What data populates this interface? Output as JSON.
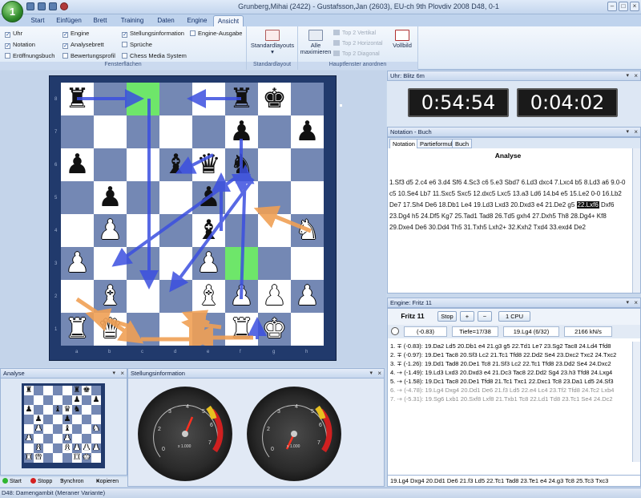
{
  "window": {
    "title": "Grunberg,Mihai (2422) - Gustafsson,Jan (2603), EU-ch 9th Plovdiv 2008 D48, 0-1",
    "logo_glyph": "1"
  },
  "ribbon": {
    "tabs": [
      "Start",
      "Einfügen",
      "Brett",
      "Training",
      "Daten",
      "Engine",
      "Ansicht"
    ],
    "active_tab": "Ansicht",
    "fensterflaechen": {
      "label": "Fensterflächen",
      "checkboxes": [
        {
          "label": "Uhr",
          "checked": true
        },
        {
          "label": "Notation",
          "checked": true
        },
        {
          "label": "Eröffnungsbuch",
          "checked": false
        },
        {
          "label": "Engine",
          "checked": true
        },
        {
          "label": "Analysebrett",
          "checked": true
        },
        {
          "label": "Bewertungsprofil",
          "checked": false
        },
        {
          "label": "Stellungsinformation",
          "checked": true
        },
        {
          "label": "Sprüche",
          "checked": false
        },
        {
          "label": "Chess Media System",
          "checked": false
        },
        {
          "label": "Engine-Ausgabe",
          "checked": false
        }
      ]
    },
    "standardlayout": {
      "label": "Standardlayout",
      "button": "Standardlayouts"
    },
    "hauptfenster": {
      "label": "Hauptfenster anordnen",
      "maximize": "Alle maximieren",
      "top2_vertical": "Top 2 Vertikal",
      "top2_horizontal": "Top 2 Horizontal",
      "top2_diagonal": "Top 2 Diagonal",
      "fullscreen": "Vollbild"
    }
  },
  "board": {
    "files": [
      "a",
      "b",
      "c",
      "d",
      "e",
      "f",
      "g",
      "h"
    ],
    "ranks": [
      "8",
      "7",
      "6",
      "5",
      "4",
      "3",
      "2",
      "1"
    ]
  },
  "clock": {
    "title": "Uhr: Blitz 6m",
    "white_time": "0:54:54",
    "black_time": "0:04:02"
  },
  "notation": {
    "title": "Notation - Buch",
    "tabs": [
      "Notation",
      "Partieformular",
      "Buch"
    ],
    "active_tab": "Notation",
    "heading": "Analyse",
    "moves_before": "1.Sf3 d5 2.c4 e6 3.d4 Sf6 4.Sc3 c6 5.e3 Sbd7 6.Ld3 dxc4 7.Lxc4 b5 8.Ld3 a6 9.0-0 c5 10.Se4 Lb7 11.Sxc5 Sxc5 12.dxc5 Lxc5 13.a3 Ld6 14.b4 e5 15.Le2 0-0 16.Lb2 De7 17.Sh4 De6 18.Db1 Le4 19.Ld3 Lxd3 20.Dxd3 e4 21.De2 g5",
    "current_move": "22.Lxf6",
    "moves_after": "Dxf6 23.Dg4 h5 24.Df5 Kg7 25.Tad1 Tad8 26.Td5 gxh4 27.Dxh5 Th8 28.Dg4+ Kf8 29.Dxe4 De6 30.Dd4 Th5 31.Txh5 Lxh2+ 32.Kxh2 Txd4 33.exd4 De2"
  },
  "engine": {
    "title": "Engine: Fritz 11",
    "name": "Fritz 11",
    "stop": "Stop",
    "plus": "+",
    "minus": "−",
    "cpu": "1 CPU",
    "eval": "(-0.83)",
    "depth": "Tiefe=17/38",
    "current_move": "19.Lg4 (6/32)",
    "speed": "2166 kN/s",
    "lines": [
      "1. ∓ (-0.83): 19.Da2 Ld5 20.Db1 e4 21.g3 g5 22.Td1 Le7 23.Sg2 Tac8 24.Ld4 Tfd8",
      "2. ∓ (-0.97): 19.De1 Tac8 20.Sf3 Lc2 21.Tc1 Tfd8 22.Dd2 Se4 23.Dxc2 Txc2 24.Txc2",
      "3. ∓ (-1.26): 19.Dd1 Tad8 20.De1 Tc8 21.Sf3 Lc2 22.Tc1 Tfd8 23.Dd2 Se4 24.Dxc2",
      "4. -+ (-1.49): 19.Ld3 Lxd3 20.Dxd3 e4 21.Dc3 Tac8 22.Dd2 Sg4 23.h3 Tfd8 24.Lxg4",
      "5. -+ (-1.58): 19.Dc1 Tac8 20.De1 Tfd8 21.Tc1 Txc1 22.Dxc1 Tc8 23.Da1 Ld5 24.Sf3",
      "6. -+ (-4.78): 19.Lg4 Dxg4 20.Dd1 De6 21.f3 Ld5 22.e4 Lc4 23.Tf2 Tfd8 24.Tc2 Lxb4",
      "7. -+ (-5.31): 19.Sg6 Lxb1 20.Sxf8 Lxf8 21.Txb1 Tc8 22.Ld1 Td8 23.Tc1 Se4 24.Dc2"
    ],
    "grey_from": 5,
    "bottom_line": "19.Lg4 Dxg4 20.Dd1 De6 21.f3 Ld5 22.Tc1 Tad8 23.Te1 e4 24.g3 Tc8 25.Tc3 Txc3"
  },
  "analysis": {
    "title": "Analyse",
    "buttons": [
      "Start",
      "Stopp",
      "Synchron",
      "Kopieren"
    ],
    "button_colors": [
      "#2fb52f",
      "#d42020",
      "#1a1a1a",
      "#1a1a1a"
    ]
  },
  "stellung": {
    "title": "Stellungsinformation",
    "gauge1_label": "x 1.000",
    "gauge2_label": "x 1.000"
  },
  "statusbar": {
    "text": "D48: Damengambit (Meraner Variante)"
  }
}
